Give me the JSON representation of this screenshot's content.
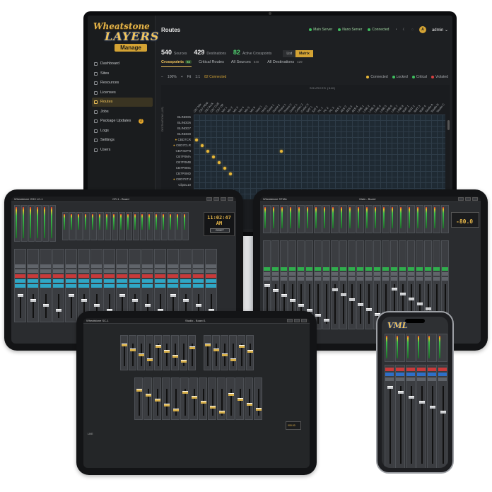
{
  "monitor": {
    "logo": {
      "brand": "Wheatstone",
      "product": "LAYERS",
      "sub": "Manage"
    },
    "nav": [
      {
        "label": "Dashboard",
        "icon": "dashboard-icon",
        "active": false
      },
      {
        "label": "Sites",
        "icon": "sites-icon",
        "active": false
      },
      {
        "label": "Resources",
        "icon": "resources-icon",
        "active": false
      },
      {
        "label": "Licenses",
        "icon": "key-icon",
        "active": false
      },
      {
        "label": "Routes",
        "icon": "routes-icon",
        "active": true
      },
      {
        "label": "Jobs",
        "icon": "jobs-icon",
        "active": false
      },
      {
        "label": "Package Updates",
        "icon": "package-icon",
        "active": false,
        "badge": "2"
      },
      {
        "label": "Logs",
        "icon": "logs-icon",
        "active": false
      },
      {
        "label": "Settings",
        "icon": "gear-icon",
        "active": false
      },
      {
        "label": "Users",
        "icon": "users-icon",
        "active": false
      }
    ],
    "title": "Routes",
    "topbar": {
      "main_server": "Main Server",
      "nano_server": "Nano Server",
      "connected": "Connected",
      "user_initial": "A",
      "user": "admin"
    },
    "stats": [
      {
        "value": "540",
        "label": "Sources",
        "color": "#f0f0f0"
      },
      {
        "value": "429",
        "label": "Destinations",
        "color": "#f0f0f0"
      },
      {
        "value": "82",
        "label": "Active Crosspoints",
        "color": "#4fcf6f"
      }
    ],
    "view_toggle": {
      "list": "List",
      "matrix": "Matrix"
    },
    "tabs": [
      {
        "label": "Crosspoints",
        "count": "82",
        "active": true
      },
      {
        "label": "Critical Routes",
        "count": "",
        "active": false
      },
      {
        "label": "All Sources",
        "count": "540",
        "active": false
      },
      {
        "label": "All Destinations",
        "count": "429",
        "active": false
      }
    ],
    "toolbar": {
      "zoom_out": "−",
      "zoom": "100%",
      "zoom_in": "+",
      "fit": "Fit",
      "one_to_one": "1:1",
      "connected": "82 Connected"
    },
    "legend": [
      {
        "label": "Connected",
        "color": "#e9b838"
      },
      {
        "label": "Locked",
        "color": "#3fbf5f"
      },
      {
        "label": "Critical",
        "color": "#3fbf5f"
      },
      {
        "label": "Violated",
        "color": "#d84040"
      }
    ],
    "sources_header": "SOURCES (540)",
    "destinations_header": "DESTINATIONS (429)",
    "rows": [
      {
        "label": "BLINDD5",
        "mark": false
      },
      {
        "label": "BLINDD6",
        "mark": false
      },
      {
        "label": "BLINDD7",
        "mark": false
      },
      {
        "label": "BLINDD8",
        "mark": false
      },
      {
        "label": "CBD7CR",
        "mark": true
      },
      {
        "label": "CBD7CLR",
        "mark": true
      },
      {
        "label": "CB7HDPN",
        "mark": false
      },
      {
        "label": "CB7P0MA",
        "mark": false
      },
      {
        "label": "CB7P0MB",
        "mark": false
      },
      {
        "label": "CB7P0MC",
        "mark": false
      },
      {
        "label": "CB7P0MD",
        "mark": false
      },
      {
        "label": "CBD7STU",
        "mark": true
      },
      {
        "label": "Clip3L10",
        "mark": false
      },
      {
        "label": "Connect1",
        "mark": true
      }
    ],
    "columns": [
      "CB7 Mix",
      "CB7 PGM",
      "CB7 AUX",
      "CB7 CUE",
      "CB7 Off",
      "Mic 1",
      "Mic 2",
      "Mic 3",
      "Mic 4",
      "Mic 5",
      "Mic 6",
      "Host 1",
      "Host 2",
      "Guest 1",
      "Guest 2",
      "Phone 1",
      "Phone 2",
      "Codec 1",
      "Codec 2",
      "Codec 3",
      "SAT 1",
      "SAT 2",
      "PC 1",
      "PC 2",
      "PC 3",
      "AES 1",
      "AES 2",
      "AES 3",
      "AES 4",
      "LINE 1",
      "LINE 2",
      "LINE 3",
      "LINE 4",
      "LINE 5",
      "LINE 6",
      "LINE 7",
      "LINE 8",
      "RMT 1",
      "RMT 2",
      "RMT 3",
      "RMT 4",
      "Studio A",
      "Studio B",
      "Studio C"
    ],
    "crosspoints": [
      {
        "row": 4,
        "col": 0
      },
      {
        "row": 5,
        "col": 1
      },
      {
        "row": 6,
        "col": 2
      },
      {
        "row": 7,
        "col": 3
      },
      {
        "row": 8,
        "col": 4
      },
      {
        "row": 9,
        "col": 5
      },
      {
        "row": 10,
        "col": 6
      },
      {
        "row": 6,
        "col": 15
      }
    ]
  },
  "tablet_left": {
    "title": "Wheatstone  GSX LC-1",
    "screen": "CR-1 - Board",
    "clock": "11:02:47 AM",
    "clock_btn": "RESET"
  },
  "tablet_right": {
    "title": "Wheatstone  STMix",
    "screen": "Main - Board",
    "peak": "-80.0"
  },
  "tablet_bottom": {
    "title": "Wheatstone  SC-1",
    "screen": "Studio - Board 1",
    "bottom_left": "LIVE",
    "readout": "000.00"
  },
  "phone": {
    "logo": "VML"
  },
  "colors": {
    "accent": "#d4a334",
    "connected": "#e9b838",
    "ok": "#3fbf5f"
  }
}
